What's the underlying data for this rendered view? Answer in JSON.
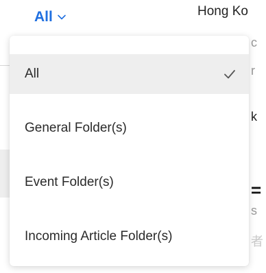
{
  "header": {
    "location_text": "Hong Ko"
  },
  "filter": {
    "current_label": "All",
    "options": [
      {
        "label": "All",
        "selected": true
      },
      {
        "label": "General Folder(s)",
        "selected": false
      },
      {
        "label": "Event Folder(s)",
        "selected": false
      },
      {
        "label": "Incoming Article Folder(s)",
        "selected": false
      }
    ]
  },
  "background_fragments": [
    "c",
    "r",
    "k",
    "=",
    "s",
    "者"
  ],
  "colors": {
    "accent": "#1f6fe0",
    "selected_bg": "#eeeeee",
    "check": "#555555"
  },
  "icons": {
    "trigger": "chevron-down-icon",
    "selected": "check-icon"
  }
}
